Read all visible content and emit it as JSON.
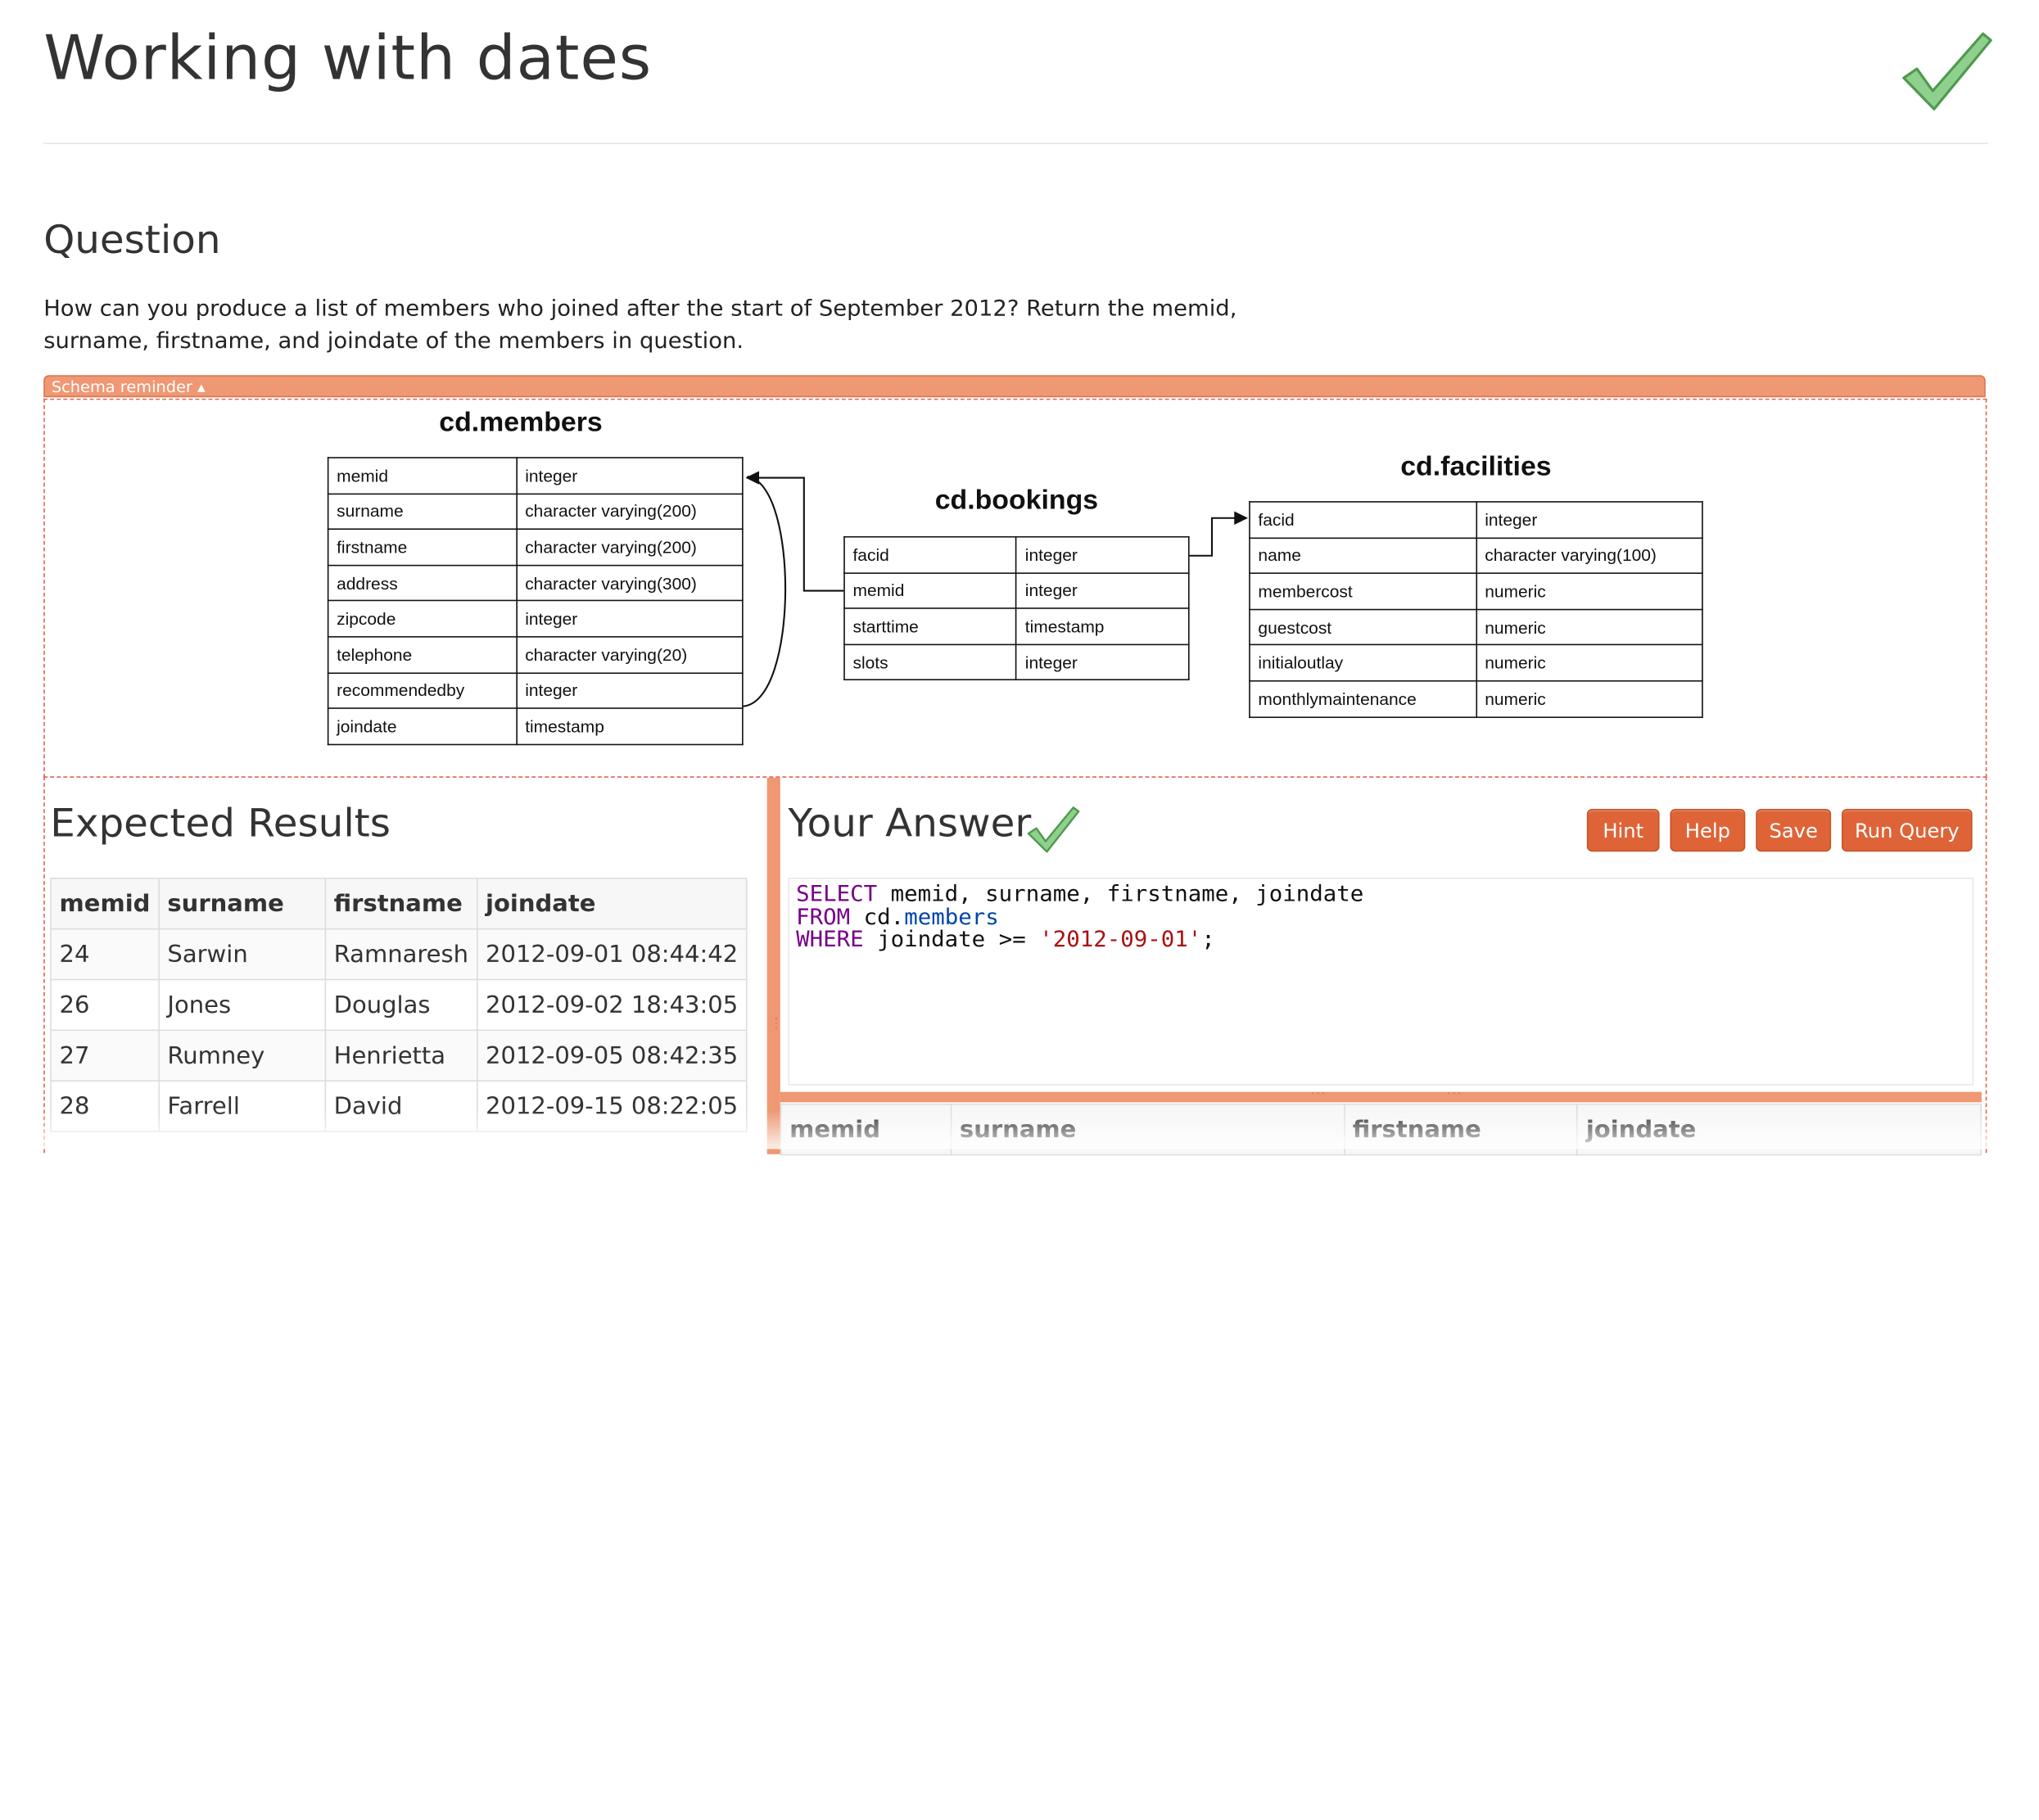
{
  "page": {
    "title": "Working with dates",
    "status_icon": "checkmark-icon"
  },
  "question": {
    "heading": "Question",
    "text": "How can you produce a list of members who joined after the start of September 2012? Return the memid, surname, firstname, and joindate of the members in question."
  },
  "schema": {
    "toggle_label": "Schema reminder ▴",
    "tables": [
      {
        "name": "cd.members",
        "columns": [
          [
            "memid",
            "integer"
          ],
          [
            "surname",
            "character varying(200)"
          ],
          [
            "firstname",
            "character varying(200)"
          ],
          [
            "address",
            "character varying(300)"
          ],
          [
            "zipcode",
            "integer"
          ],
          [
            "telephone",
            "character varying(20)"
          ],
          [
            "recommendedby",
            "integer"
          ],
          [
            "joindate",
            "timestamp"
          ]
        ]
      },
      {
        "name": "cd.bookings",
        "columns": [
          [
            "facid",
            "integer"
          ],
          [
            "memid",
            "integer"
          ],
          [
            "starttime",
            "timestamp"
          ],
          [
            "slots",
            "integer"
          ]
        ]
      },
      {
        "name": "cd.facilities",
        "columns": [
          [
            "facid",
            "integer"
          ],
          [
            "name",
            "character varying(100)"
          ],
          [
            "membercost",
            "numeric"
          ],
          [
            "guestcost",
            "numeric"
          ],
          [
            "initialoutlay",
            "numeric"
          ],
          [
            "monthlymaintenance",
            "numeric"
          ]
        ]
      }
    ]
  },
  "expected": {
    "heading": "Expected Results",
    "headers": [
      "memid",
      "surname",
      "firstname",
      "joindate"
    ],
    "rows": [
      [
        "24",
        "Sarwin",
        "Ramnaresh",
        "2012-09-01 08:44:42"
      ],
      [
        "26",
        "Jones",
        "Douglas",
        "2012-09-02 18:43:05"
      ],
      [
        "27",
        "Rumney",
        "Henrietta",
        "2012-09-05 08:42:35"
      ],
      [
        "28",
        "Farrell",
        "David",
        "2012-09-15 08:22:05"
      ]
    ]
  },
  "answer": {
    "heading": "Your Answer",
    "buttons": {
      "hint": "Hint",
      "help": "Help",
      "save": "Save",
      "run": "Run Query"
    },
    "query_lines": [
      [
        [
          "kw",
          "SELECT"
        ],
        [
          "",
          " memid, surname, firstname, joindate"
        ]
      ],
      [
        [
          "kw",
          "FROM"
        ],
        [
          "",
          " cd."
        ],
        [
          "def",
          "members"
        ]
      ],
      [
        [
          "kw",
          "WHERE"
        ],
        [
          "",
          " joindate >= "
        ],
        [
          "str",
          "'2012-09-01'"
        ],
        [
          "",
          ";"
        ]
      ]
    ],
    "result_headers": [
      "memid",
      "surname",
      "firstname",
      "joindate"
    ]
  },
  "colors": {
    "accent": "#de6438",
    "schema_bar": "#ef9873",
    "check": "#7bc47b"
  }
}
